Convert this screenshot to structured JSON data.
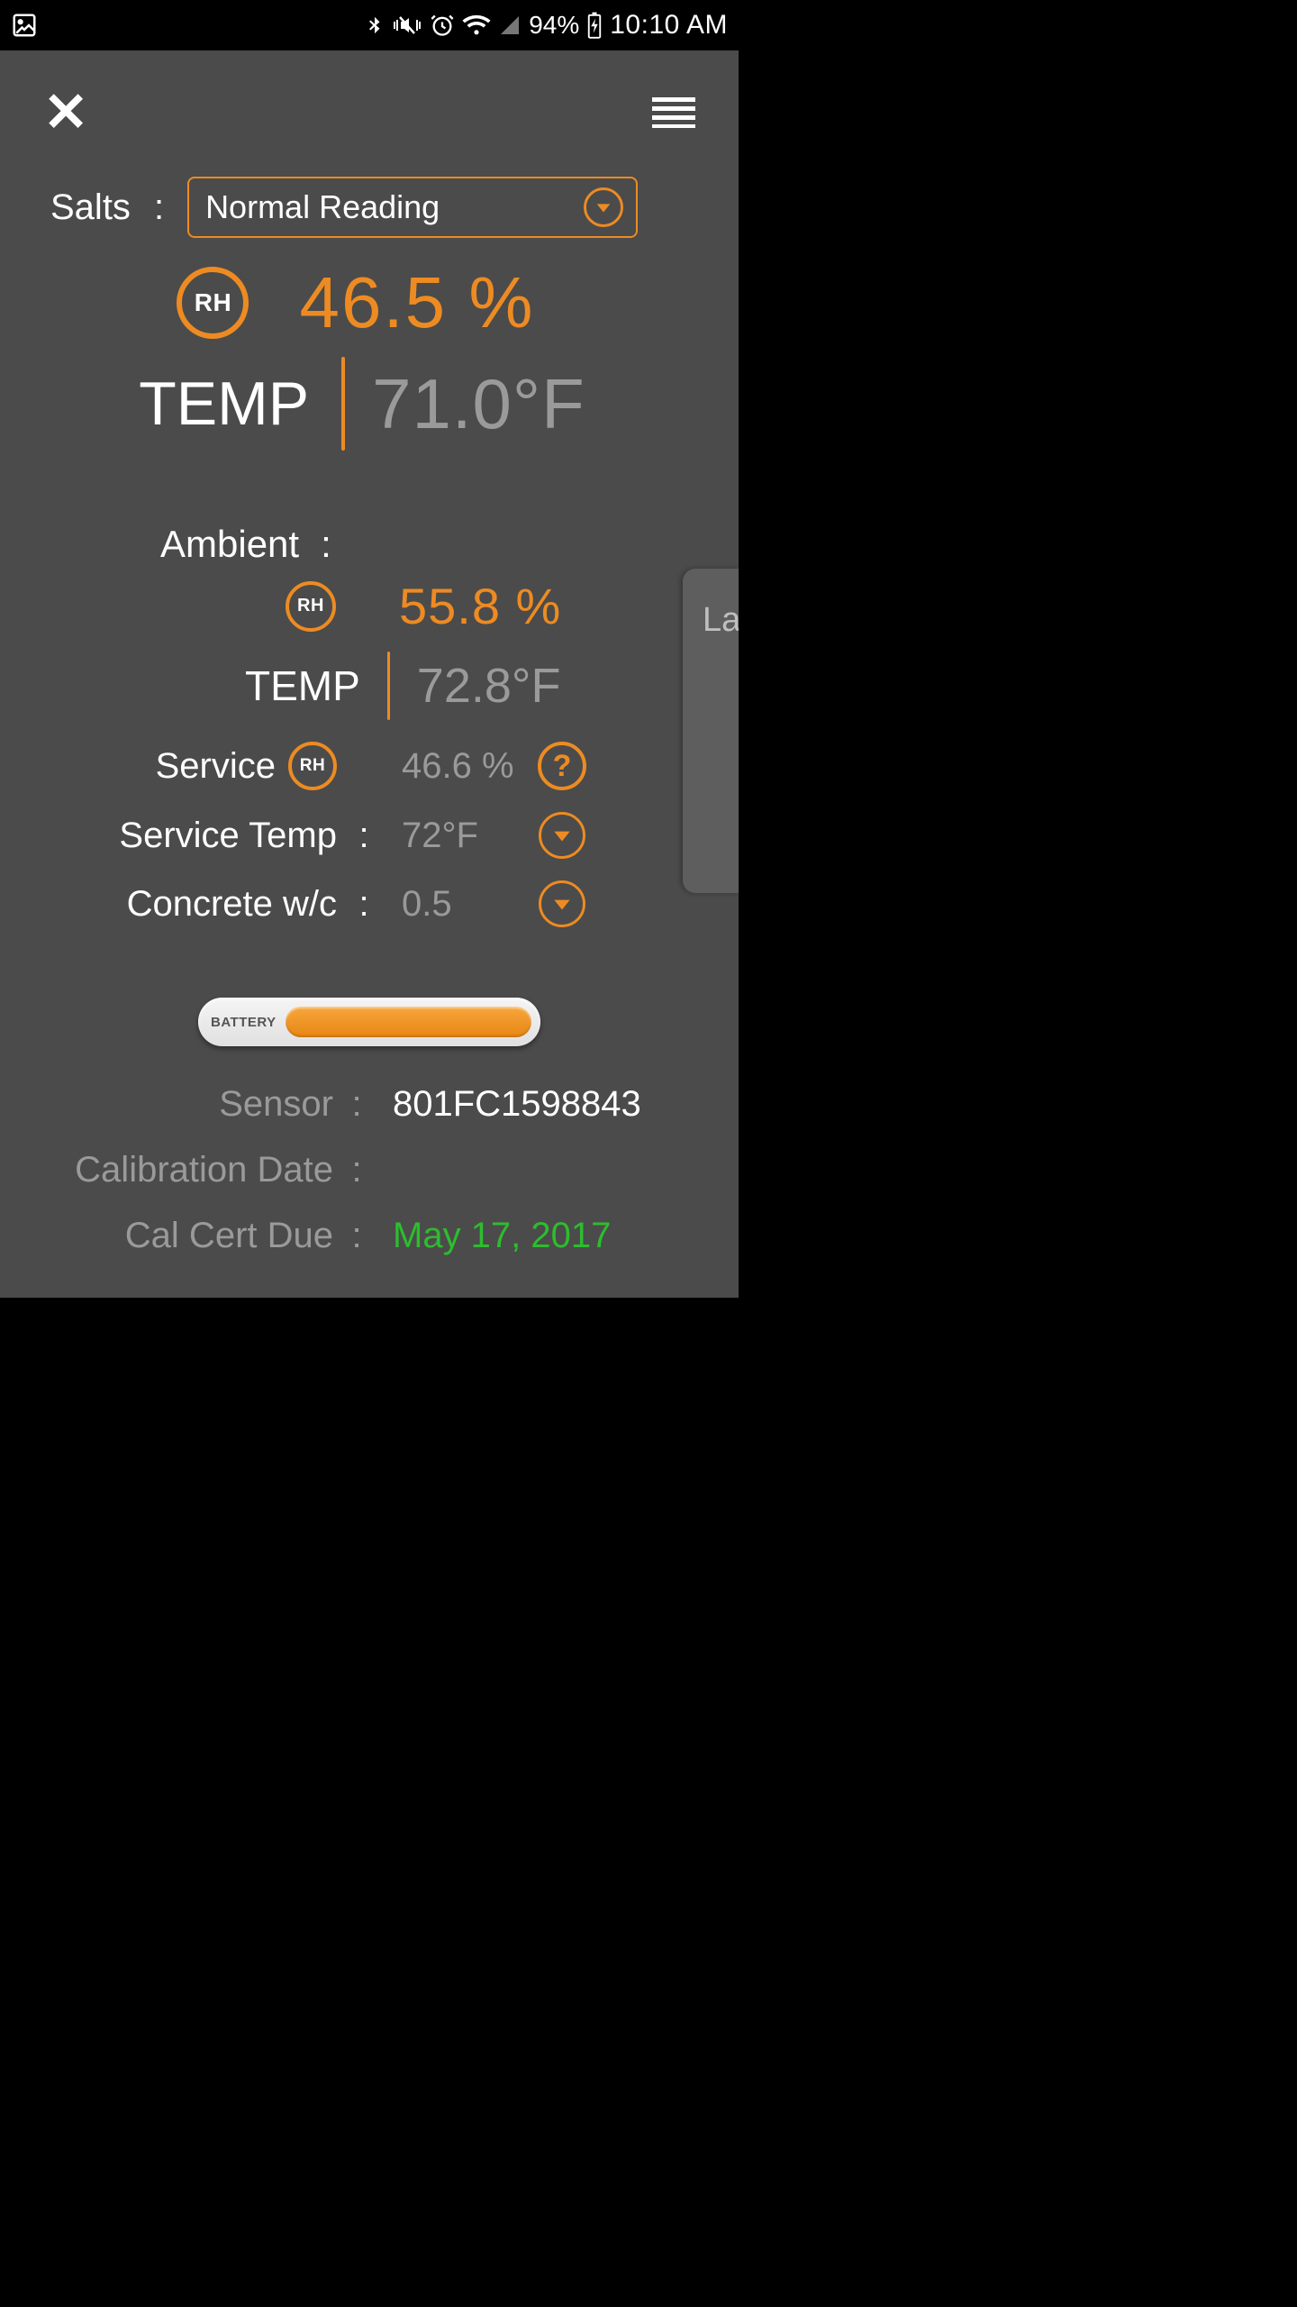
{
  "status": {
    "battery_pct": "94%",
    "time": "10:10 AM"
  },
  "salts": {
    "label": "Salts",
    "selected": "Normal Reading"
  },
  "reading": {
    "rh_badge": "RH",
    "rh_value": "46.5 %",
    "temp_label": "TEMP",
    "temp_value": "71.0°F"
  },
  "ambient": {
    "label": "Ambient",
    "rh_badge": "RH",
    "rh_value": "55.8 %",
    "temp_label": "TEMP",
    "temp_value": "72.8°F"
  },
  "service": {
    "rh_label": "Service",
    "rh_badge": "RH",
    "rh_value": "46.6 %",
    "temp_label": "Service Temp",
    "temp_value": "72°F",
    "wc_label": "Concrete w/c",
    "wc_value": "0.5"
  },
  "battery": {
    "label": "BATTERY"
  },
  "info": {
    "sensor_label": "Sensor",
    "sensor_value": "801FC1598843",
    "cal_date_label": "Calibration Date",
    "cal_date_value": "",
    "cal_due_label": "Cal Cert Due",
    "cal_due_value": "May 17, 2017"
  },
  "side_tab": {
    "text": "La"
  }
}
